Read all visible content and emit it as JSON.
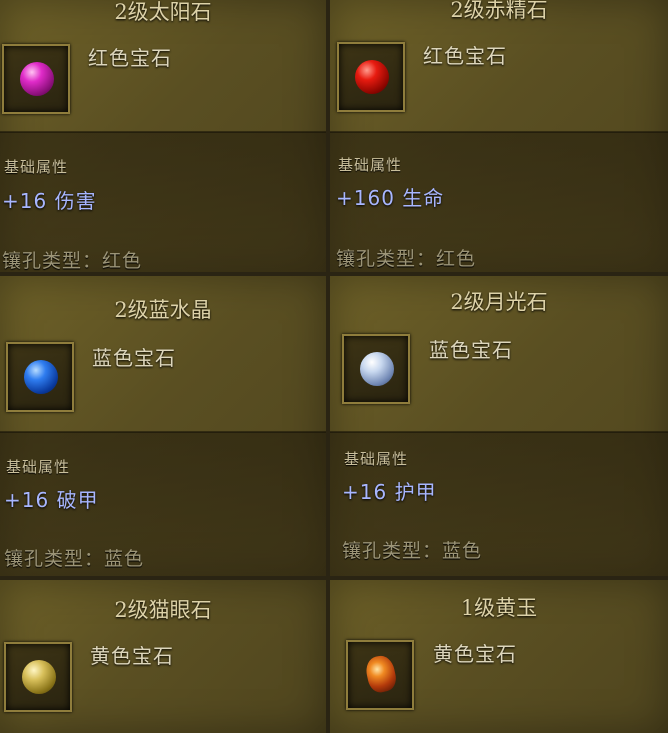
{
  "cards": [
    {
      "title": "2级太阳石",
      "gem_type": "红色宝石",
      "gem_color": "magenta",
      "attr_label": "基础属性",
      "attr_value": "+16 伤害",
      "socket": "镶孔类型：红色"
    },
    {
      "title": "2级赤精石",
      "gem_type": "红色宝石",
      "gem_color": "red",
      "attr_label": "基础属性",
      "attr_value": "+160 生命",
      "socket": "镶孔类型：红色"
    },
    {
      "title": "2级蓝水晶",
      "gem_type": "蓝色宝石",
      "gem_color": "blue",
      "attr_label": "基础属性",
      "attr_value": "+16 破甲",
      "socket": "镶孔类型：蓝色"
    },
    {
      "title": "2级月光石",
      "gem_type": "蓝色宝石",
      "gem_color": "white",
      "attr_label": "基础属性",
      "attr_value": "+16 护甲",
      "socket": "镶孔类型：蓝色"
    },
    {
      "title": "2级猫眼石",
      "gem_type": "黄色宝石",
      "gem_color": "yellow"
    },
    {
      "title": "1级黄玉",
      "gem_type": "黄色宝石",
      "gem_color": "orange"
    }
  ]
}
